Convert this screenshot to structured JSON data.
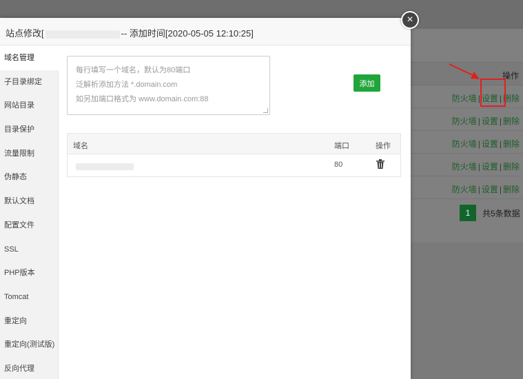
{
  "modal": {
    "title_prefix": "站点修改[",
    "title_suffix": "-- 添加时间[2020-05-05 12:10:25]",
    "close_glyph": "×"
  },
  "sidebar": {
    "items": [
      {
        "label": "域名管理",
        "active": true
      },
      {
        "label": "子目录绑定"
      },
      {
        "label": "网站目录"
      },
      {
        "label": "目录保护"
      },
      {
        "label": "流量限制"
      },
      {
        "label": "伪静态"
      },
      {
        "label": "默认文档"
      },
      {
        "label": "配置文件"
      },
      {
        "label": "SSL"
      },
      {
        "label": "PHP版本"
      },
      {
        "label": "Tomcat"
      },
      {
        "label": "重定向"
      },
      {
        "label": "重定向(测试版)"
      },
      {
        "label": "反向代理"
      }
    ]
  },
  "domain_form": {
    "placeholder_line1": "每行填写一个域名，默认为80端口",
    "placeholder_line2": "泛解析添加方法 *.domain.com",
    "placeholder_line3": "如另加端口格式为 www.domain.com:88",
    "add_button": "添加"
  },
  "domain_table": {
    "headers": {
      "domain": "域名",
      "port": "端口",
      "action": "操作"
    },
    "rows": [
      {
        "domain": "",
        "port": "80",
        "delete_icon": "trash-icon"
      }
    ]
  },
  "background": {
    "header_action": "操作",
    "row_actions": {
      "firewall": "防火墙",
      "sep": "|",
      "settings": "设置",
      "delete": "删除"
    },
    "row_count": 5,
    "pager": {
      "current": "1",
      "total_text": "共5条数据"
    }
  },
  "colors": {
    "accent": "#20a53a",
    "highlight": "#e02020"
  }
}
